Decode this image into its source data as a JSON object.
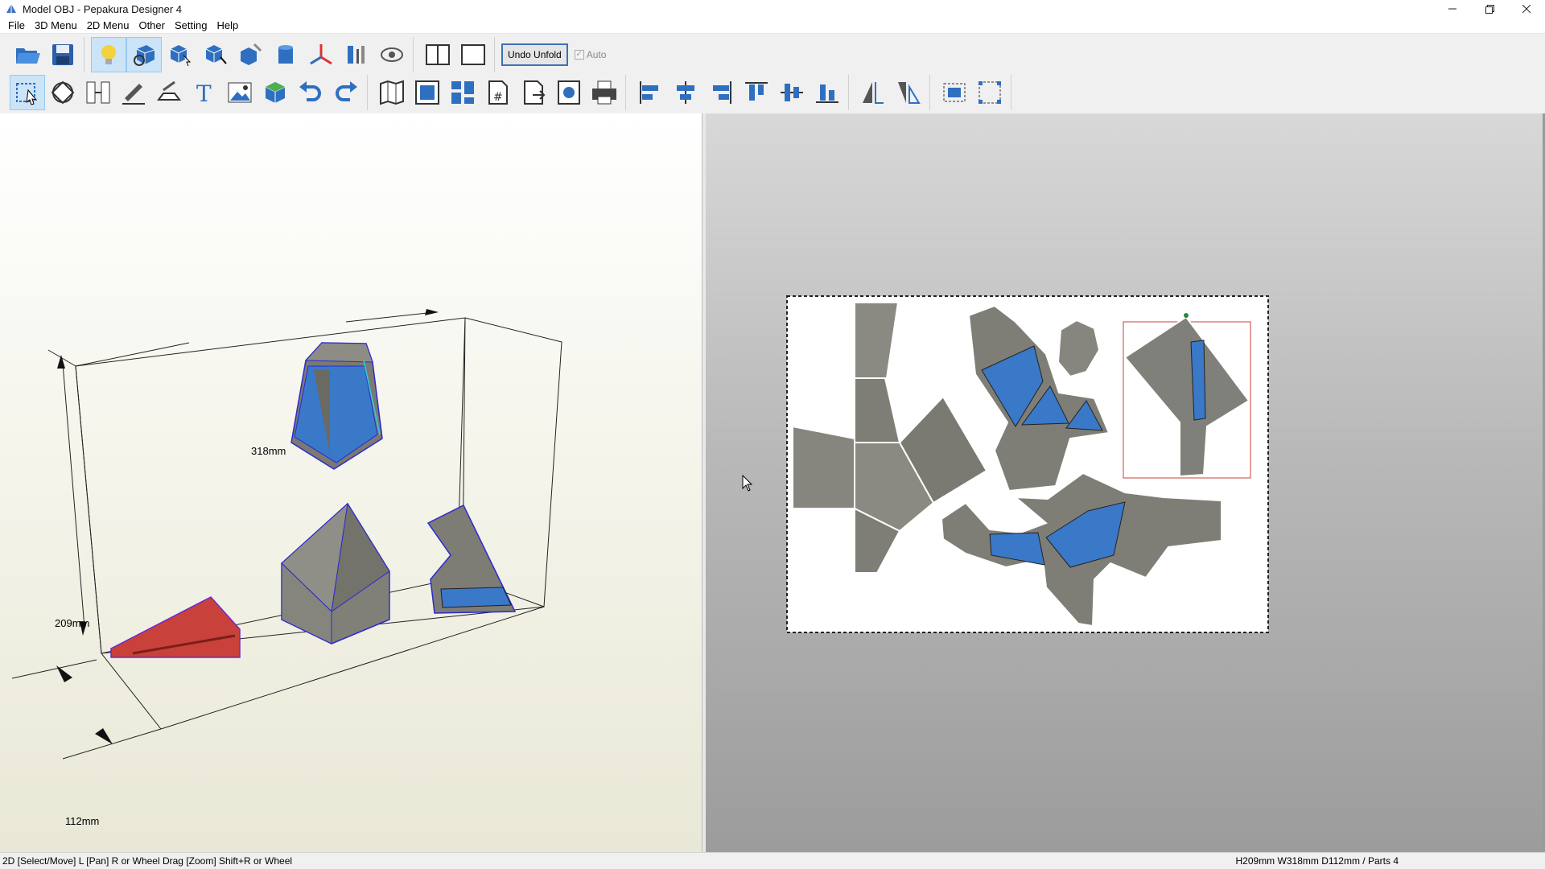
{
  "window": {
    "title": "Model OBJ - Pepakura Designer 4",
    "controls": [
      "minimize",
      "maximize",
      "close"
    ]
  },
  "menu": {
    "items": [
      "File",
      "3D Menu",
      "2D Menu",
      "Other",
      "Setting",
      "Help"
    ]
  },
  "toolbar": {
    "undo_unfold_label": "Undo Unfold",
    "auto_label": "Auto",
    "auto_checked": true
  },
  "view3d": {
    "width_label": "318mm",
    "height_label": "209mm",
    "depth_label": "112mm"
  },
  "status": {
    "left": "2D [Select/Move] L [Pan] R or Wheel Drag [Zoom] Shift+R or Wheel",
    "right": "H209mm W318mm D112mm / Parts 4"
  },
  "colors": {
    "selection_red": "#c8413a",
    "model_blue": "#3a78c8",
    "stone_gray": "#8a8a82",
    "edge_blue": "#2a2ad0"
  }
}
